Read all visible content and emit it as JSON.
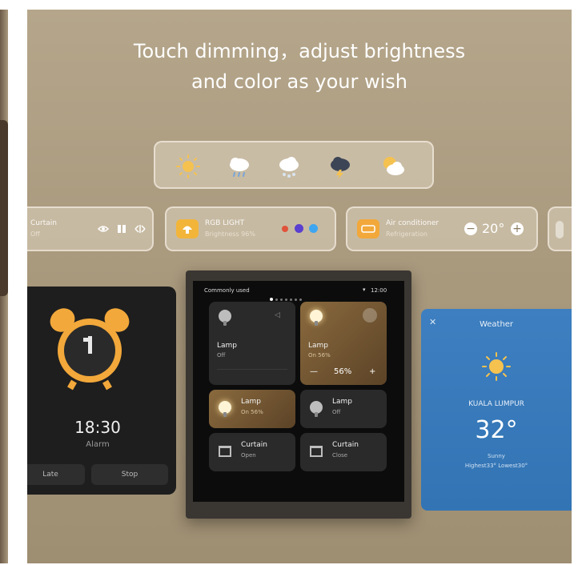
{
  "headline": {
    "line1": "Touch dimming，adjust brightness",
    "line2": "and color as your wish"
  },
  "weather_strip": {
    "icons": [
      "sun-icon",
      "cloud-rain-icon",
      "cloud-snow-icon",
      "thunderstorm-icon",
      "partly-cloudy-icon"
    ]
  },
  "cards": {
    "curtain": {
      "title": "Curtain",
      "subtitle": "Off"
    },
    "rgb": {
      "title": "RGB LIGHT",
      "subtitle": "Brightness 96%",
      "swatches": [
        "#e0533a",
        "#5a3fd0",
        "#3ea6f0"
      ]
    },
    "ac": {
      "title": "Air conditioner",
      "subtitle": "Refrigeration",
      "temperature": "20°"
    }
  },
  "alarm": {
    "time": "18:30",
    "label": "Alarm",
    "later_label": "Late",
    "stop_label": "Stop"
  },
  "device": {
    "status_left": "Commonly used",
    "status_time": "12:00",
    "tiles": [
      {
        "label": "Lamp",
        "sub": "Off"
      },
      {
        "label": "Lamp",
        "sub": "On 56%",
        "value": "56%"
      },
      {
        "label": "Lamp",
        "sub": "On 56%"
      },
      {
        "label": "Lamp",
        "sub": "Off"
      },
      {
        "label": "Curtain",
        "sub": "Open"
      },
      {
        "label": "Curtain",
        "sub": "Close"
      }
    ]
  },
  "weather": {
    "title": "Weather",
    "city": "KUALA LUMPUR",
    "temperature": "32°",
    "condition": "Sunny",
    "hilo": "Highest33° Lowest30°"
  },
  "colors": {
    "background": "#a8987c",
    "accent_orange": "#f2a83a",
    "weather_blue": "#3274b4"
  }
}
